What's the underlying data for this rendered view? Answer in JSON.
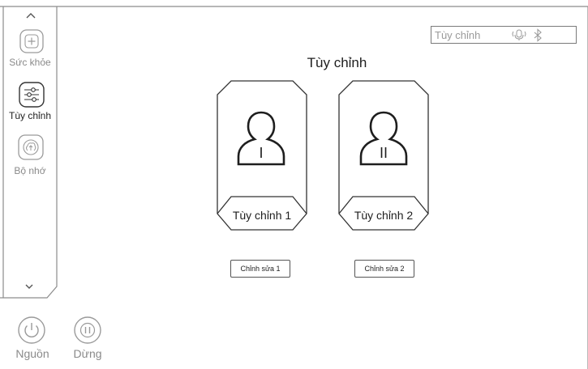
{
  "sidebar": {
    "items": [
      {
        "label": "Sức khỏe",
        "icon": "health-plus-icon",
        "active": false
      },
      {
        "label": "Tùy chỉnh",
        "icon": "sliders-icon",
        "active": true
      },
      {
        "label": "Bộ nhớ",
        "icon": "memory-icon",
        "active": false
      }
    ],
    "scroll_up_icon": "chevron-up-icon",
    "scroll_down_icon": "chevron-down-icon"
  },
  "bottom_controls": {
    "power": {
      "label": "Nguồn",
      "icon": "power-icon"
    },
    "pause": {
      "label": "Dừng",
      "icon": "pause-icon"
    }
  },
  "status_bar": {
    "mode_text": "Tùy chỉnh",
    "icons": [
      "microphone-icon",
      "bluetooth-icon"
    ]
  },
  "main": {
    "title": "Tùy chỉnh",
    "profiles": [
      {
        "label": "Tùy chỉnh 1",
        "numeral": "I",
        "edit_label": "Chỉnh sửa 1"
      },
      {
        "label": "Tùy chỉnh 2",
        "numeral": "II",
        "edit_label": "Chỉnh sửa 2"
      }
    ]
  },
  "colors": {
    "line": "#555555",
    "muted": "#8a8a8a",
    "text": "#1e1e1e"
  }
}
